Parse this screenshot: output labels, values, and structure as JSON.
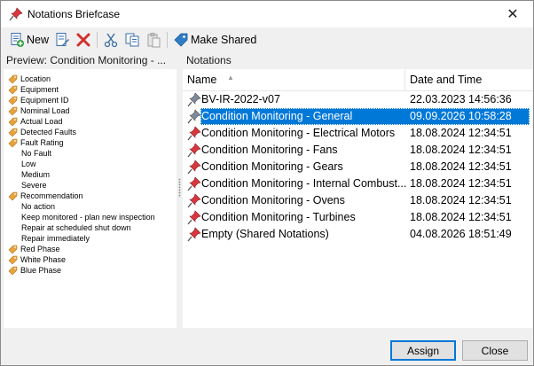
{
  "window": {
    "title": "Notations Briefcase",
    "close_glyph": "✕"
  },
  "toolbar": {
    "new_label": "New",
    "make_shared_label": "Make Shared"
  },
  "preview": {
    "header": "Preview: Condition Monitoring - ...",
    "items": [
      {
        "label": "Location",
        "tag": true
      },
      {
        "label": "Equipment",
        "tag": true
      },
      {
        "label": "Equipment ID",
        "tag": true
      },
      {
        "label": "Nominal Load",
        "tag": true
      },
      {
        "label": "Actual Load",
        "tag": true
      },
      {
        "label": "Detected Faults",
        "tag": true
      },
      {
        "label": "Fault Rating",
        "tag": true
      },
      {
        "label": "No Fault",
        "tag": false
      },
      {
        "label": "Low",
        "tag": false
      },
      {
        "label": "Medium",
        "tag": false
      },
      {
        "label": "Severe",
        "tag": false
      },
      {
        "label": "Recommendation",
        "tag": true
      },
      {
        "label": "No action",
        "tag": false
      },
      {
        "label": "Keep monitored - plan new inspection",
        "tag": false
      },
      {
        "label": "Repair at scheduled shut down",
        "tag": false
      },
      {
        "label": "Repair immediately",
        "tag": false
      },
      {
        "label": "Red Phase",
        "tag": true
      },
      {
        "label": "White Phase",
        "tag": true
      },
      {
        "label": "Blue Phase",
        "tag": true
      }
    ]
  },
  "notations": {
    "header": "Notations",
    "col_name": "Name",
    "col_date": "Date and Time",
    "rows": [
      {
        "name": "BV-IR-2022-v07",
        "date": "22.03.2023 14:56:36",
        "selected": false,
        "pin": "gray"
      },
      {
        "name": "Condition Monitoring -  General",
        "date": "09.09.2026 10:58:28",
        "selected": true,
        "pin": "gray"
      },
      {
        "name": "Condition Monitoring - Electrical Motors",
        "date": "18.08.2024 12:34:51",
        "selected": false,
        "pin": "red"
      },
      {
        "name": "Condition Monitoring - Fans",
        "date": "18.08.2024 12:34:51",
        "selected": false,
        "pin": "red"
      },
      {
        "name": "Condition Monitoring - Gears",
        "date": "18.08.2024 12:34:51",
        "selected": false,
        "pin": "red"
      },
      {
        "name": "Condition Monitoring - Internal Combust...",
        "date": "18.08.2024 12:34:51",
        "selected": false,
        "pin": "red"
      },
      {
        "name": "Condition Monitoring - Ovens",
        "date": "18.08.2024 12:34:51",
        "selected": false,
        "pin": "red"
      },
      {
        "name": "Condition Monitoring - Turbines",
        "date": "18.08.2024 12:34:51",
        "selected": false,
        "pin": "red"
      },
      {
        "name": "Empty (Shared Notations)",
        "date": "04.08.2026 18:51:49",
        "selected": false,
        "pin": "red"
      }
    ]
  },
  "buttons": {
    "assign": "Assign",
    "close": "Close"
  },
  "colors": {
    "selection": "#0078d7",
    "pin_red": "#d9363e",
    "tag_orange": "#e8a33d",
    "shared_blue": "#2f7cc7"
  }
}
